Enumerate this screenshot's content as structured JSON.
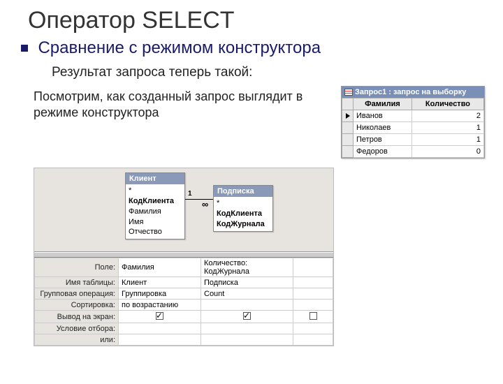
{
  "title": "Оператор SELECT",
  "subtitle": "Сравнение с режимом конструктора",
  "text1": "Результат запроса теперь такой:",
  "text2": "Посмотрим, как созданный запрос выглядит в режиме конструктора",
  "result_window": {
    "title": "Запрос1 : запрос на выборку",
    "headers": [
      "Фамилия",
      "Количество"
    ],
    "rows": [
      [
        "Иванов",
        "2"
      ],
      [
        "Николаев",
        "1"
      ],
      [
        "Петров",
        "1"
      ],
      [
        "Федоров",
        "0"
      ]
    ]
  },
  "designer": {
    "tables": [
      {
        "name": "Клиент",
        "fields_star": "*",
        "f1": "КодКлиента",
        "f2": "Фамилия",
        "f3": "Имя",
        "f4": "Отчество"
      },
      {
        "name": "Подписка",
        "fields_star": "*",
        "f1": "КодКлиента",
        "f2": "КодЖурнала"
      }
    ],
    "join_left": "1",
    "join_right": "∞",
    "grid_labels": {
      "field": "Поле:",
      "table": "Имя таблицы:",
      "group": "Групповая операция:",
      "sort": "Сортировка:",
      "show": "Вывод на экран:",
      "criteria": "Условие отбора:",
      "or": "или:"
    },
    "col2": {
      "field": "Фамилия",
      "table": "Клиент",
      "group": "Группировка",
      "sort": "по возрастанию",
      "show": true
    },
    "col3": {
      "field": "Количество: КодЖурнала",
      "table": "Подписка",
      "group": "Count",
      "sort": "",
      "show": true
    }
  }
}
